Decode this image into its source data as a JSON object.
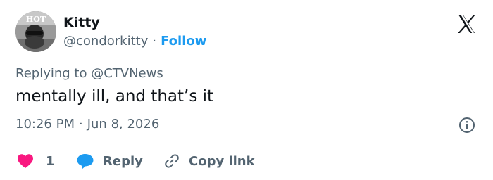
{
  "author": {
    "name": "Kitty",
    "handle": "@condorkitty",
    "separator": "·",
    "follow_label": "Follow"
  },
  "reply_context": {
    "prefix": "Replying to",
    "mention": "@CTVNews"
  },
  "tweet": {
    "text": "mentally ill, and that’s it",
    "time": "10:26 PM",
    "separator": "·",
    "date": "Jun 8, 2026"
  },
  "actions": {
    "like_count": "1",
    "reply_label": "Reply",
    "copy_link_label": "Copy link"
  },
  "icons": {
    "brand": "x-logo-icon",
    "info": "info-icon",
    "like": "heart-icon",
    "reply": "speech-bubble-icon",
    "copy": "link-icon"
  },
  "colors": {
    "text": "#0f1419",
    "secondary": "#536471",
    "accent": "#1d9bf0",
    "like": "#f91880",
    "divider": "#cfd9de"
  }
}
